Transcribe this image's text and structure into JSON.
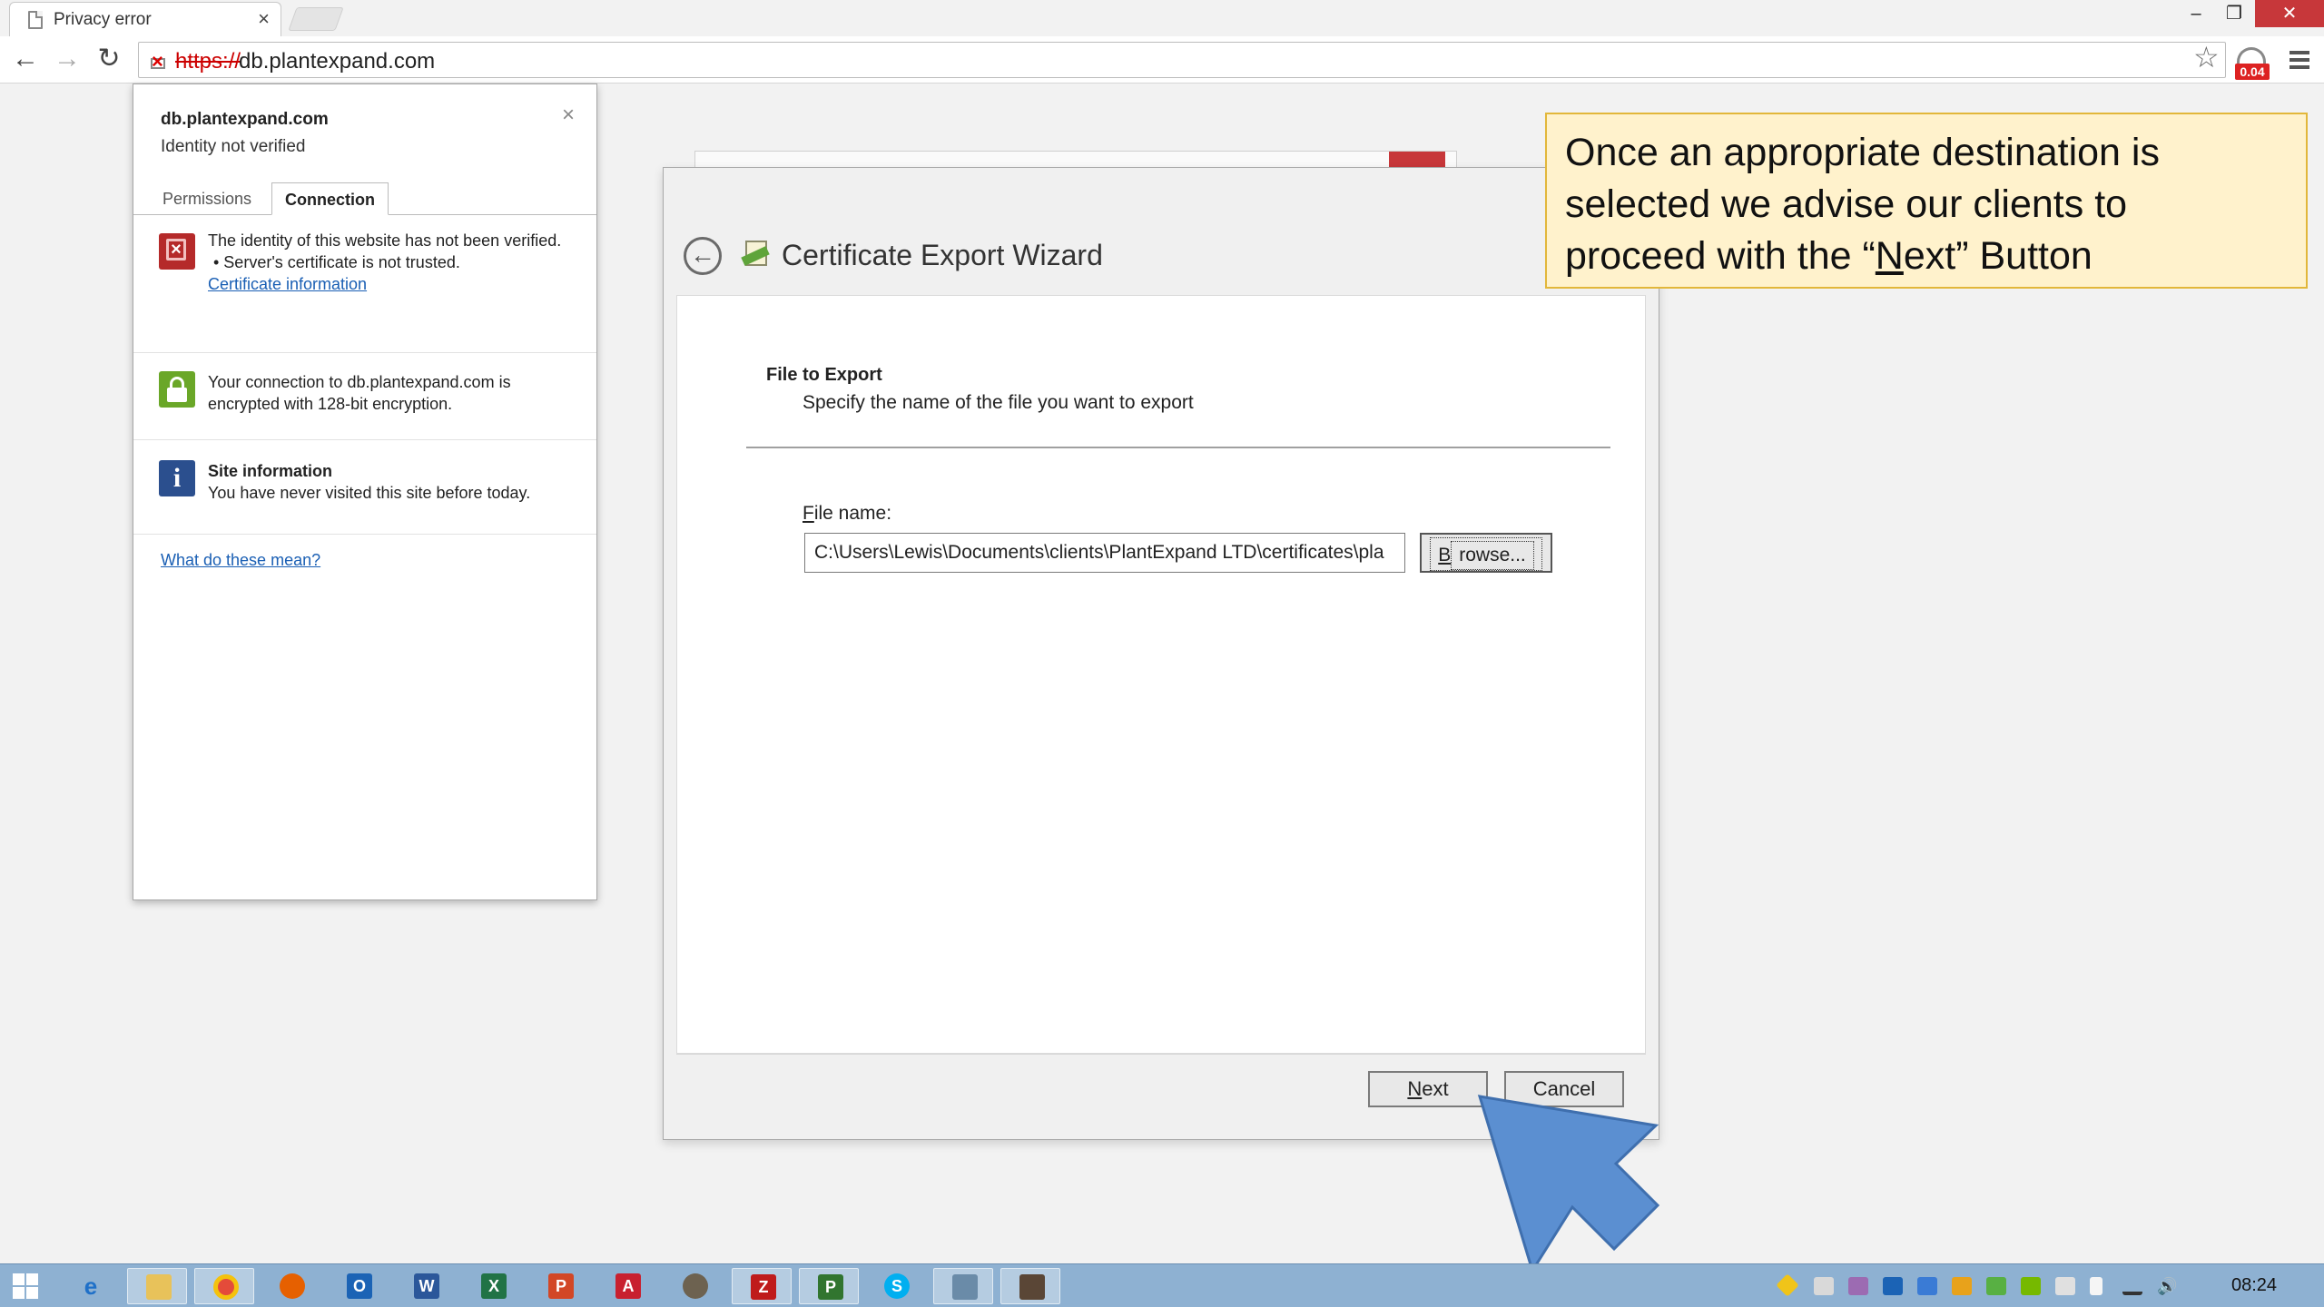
{
  "browser": {
    "tab_title": "Privacy error",
    "tab_close": "×",
    "url_scheme": "https://",
    "url_host": "db.plantexpand.com",
    "extension_badge": "0.04"
  },
  "site_info": {
    "host": "db.plantexpand.com",
    "status": "Identity not verified",
    "close": "×",
    "tabs": [
      "Permissions",
      "Connection"
    ],
    "identity_text": "The identity of this website has not been verified.",
    "identity_bullet": "• Server's certificate is not trusted.",
    "cert_link": "Certificate information",
    "connection_text": "Your connection to db.plantexpand.com is encrypted with 128-bit encryption.",
    "site_info_title": "Site information",
    "site_info_text": "You have never visited this site before today.",
    "help_link": "What do these mean?"
  },
  "wizard": {
    "title": "Certificate Export Wizard",
    "section_title": "File to Export",
    "section_desc": "Specify the name of the file you want to export",
    "file_label_access": "F",
    "file_label_rest": "ile name:",
    "file_value": "C:\\Users\\Lewis\\Documents\\clients\\PlantExpand LTD\\certificates\\pla",
    "browse_access": "B",
    "browse_rest": "rowse...",
    "next_access": "N",
    "next_rest": "ext",
    "cancel_label": "Cancel"
  },
  "callout": {
    "line1": "Once an appropriate destination is",
    "line2": "selected we advise our clients to",
    "line3_pre": "proceed with the “",
    "line3_u": "N",
    "line3_post": "ext” Button"
  },
  "taskbar": {
    "apps": [
      "start-icon",
      "internet-explorer-icon",
      "file-explorer-icon",
      "chrome-icon",
      "firefox-icon",
      "outlook-icon",
      "word-icon",
      "excel-icon",
      "powerpoint-icon",
      "acrobat-icon",
      "gimp-icon",
      "filezilla-icon",
      "project-icon",
      "skype-icon",
      "network-icon",
      "media-icon"
    ],
    "clock": "08:24"
  },
  "colors": {
    "callout_bg": "#fff2cc",
    "callout_border": "#e2b73a",
    "arrow": "#5b8fd1",
    "close_red": "#c7373a",
    "taskbar": "#8eb1d2",
    "link": "#1a5fb4"
  }
}
